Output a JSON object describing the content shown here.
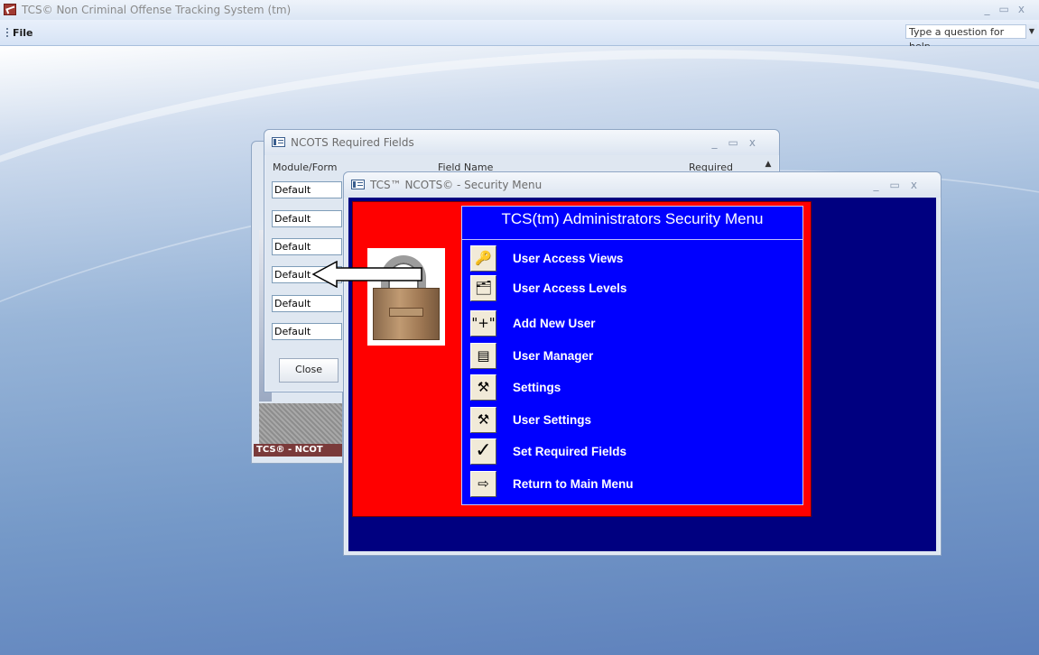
{
  "app": {
    "title": "TCS© Non Criminal Offense Tracking System (tm)",
    "window_controls": [
      "minimize-icon",
      "restore-icon",
      "close-icon"
    ]
  },
  "menubar": {
    "file_label": "File",
    "help_placeholder": "Type a question for help"
  },
  "behind_window": {
    "caption": "TCS® - NCOT"
  },
  "required_fields_window": {
    "title": "NCOTS Required Fields",
    "columns": [
      "Module/Form",
      "Field Name",
      "Required"
    ],
    "rows": [
      "Default",
      "Default",
      "Default",
      "Default",
      "Default",
      "Default"
    ],
    "close_label": "Close"
  },
  "security_window": {
    "title": "TCS™ NCOTS© - Security Menu",
    "panel_title": "TCS(tm) Administrators Security Menu",
    "items": [
      {
        "label": "User Access Views",
        "icon": "key-icon",
        "glyph": "🔑"
      },
      {
        "label": "User Access Levels",
        "icon": "users-icon",
        "glyph": "🗂"
      },
      {
        "label": "Add New User",
        "icon": "plus-icon",
        "glyph": "\"+\""
      },
      {
        "label": "User Manager",
        "icon": "form-icon",
        "glyph": "▤"
      },
      {
        "label": "Settings",
        "icon": "tools-icon",
        "glyph": "⚒"
      },
      {
        "label": "User Settings",
        "icon": "tools-icon",
        "glyph": "⚒"
      },
      {
        "label": "Set Required Fields",
        "icon": "checkmark-icon",
        "glyph": "✓"
      },
      {
        "label": "Return to Main Menu",
        "icon": "exit-door-icon",
        "glyph": "⇨"
      }
    ]
  },
  "colors": {
    "workspace": "#7599c8",
    "security_bg": "#000080",
    "red_panel": "#ff0000",
    "menu_panel": "#0000ff"
  }
}
